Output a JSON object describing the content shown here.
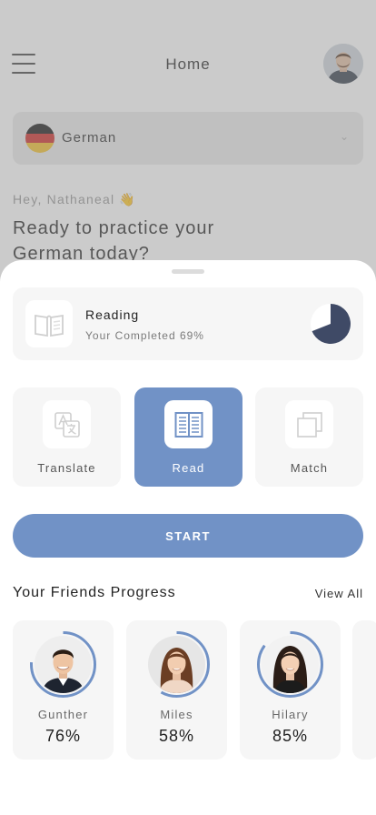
{
  "header": {
    "title": "Home"
  },
  "language": {
    "name": "German"
  },
  "greeting": {
    "text": "Hey, Nathaneal 👋",
    "headline": "Ready to practice your German today?"
  },
  "reading": {
    "title": "Reading",
    "subtitle": "Your Completed 69%",
    "progress": 0.69
  },
  "modes": [
    {
      "label": "Translate",
      "icon": "translate-icon",
      "active": false
    },
    {
      "label": "Read",
      "icon": "book-icon",
      "active": true
    },
    {
      "label": "Match",
      "icon": "copy-icon",
      "active": false
    }
  ],
  "start_label": "START",
  "friends": {
    "title": "Your Friends Progress",
    "view_all": "View All",
    "items": [
      {
        "name": "Gunther",
        "percent": "76%",
        "progress": 0.76
      },
      {
        "name": "Miles",
        "percent": "58%",
        "progress": 0.58
      },
      {
        "name": "Hilary",
        "percent": "85%",
        "progress": 0.85
      }
    ]
  },
  "colors": {
    "accent": "#7192c6",
    "pie_fill": "#3f4a66",
    "flag": [
      "#1e1e1e",
      "#d0312d",
      "#f2c230"
    ]
  }
}
